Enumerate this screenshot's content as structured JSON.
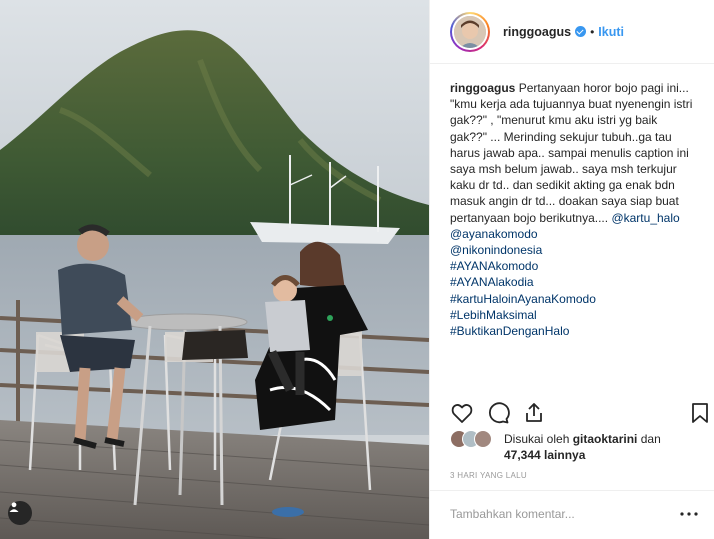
{
  "post": {
    "image_alt": "Family sitting at a table on a wooden pier with a green mountain and sailing ship in the background",
    "user_tags_icon": "person-tag-icon"
  },
  "header": {
    "username": "ringgoagus",
    "verified_icon": "verified-badge-icon",
    "dot": "•",
    "follow_label": "Ikuti"
  },
  "caption": {
    "username": "ringgoagus",
    "text": "Pertanyaan horor bojo pagi ini... \"kmu kerja ada tujuannya buat nyenengin istri gak??\" , \"menurut kmu aku istri yg baik gak??\" ... Merinding sekujur tubuh..ga tau harus jawab apa.. sampai menulis caption ini saya msh belum jawab.. saya msh terkujur kaku dr td.. dan sedikit akting ga enak bdn masuk angin dr td... doakan saya siap buat pertanyaan bojo berikutnya....",
    "inline_mentions": [
      "@kartu_halo",
      "@ayanakomodo"
    ],
    "tags": [
      "@nikonindonesia",
      "#AYANAkomodo",
      "#AYANAlakodia",
      "#kartuHaloinAyanaKomodo",
      "#LebihMaksimal",
      "#BuktikanDenganHalo"
    ]
  },
  "actions": {
    "like_icon": "heart-icon",
    "comment_icon": "comment-bubble-icon",
    "share_icon": "share-icon",
    "save_icon": "bookmark-icon"
  },
  "likes": {
    "prefix": "Disukai oleh",
    "liker": "gitaoktarini",
    "middle": " dan",
    "count": "47,344 lainnya",
    "avatar_colors": [
      "#8d6e63",
      "#b0bec5",
      "#a1887f"
    ]
  },
  "timestamp": "3 HARI YANG LALU",
  "comment": {
    "placeholder": "Tambahkan komentar...",
    "more_icon": "more-options-icon"
  },
  "colors": {
    "link": "#003569",
    "follow": "#3897f0",
    "border": "#efefef",
    "muted": "#999999"
  }
}
